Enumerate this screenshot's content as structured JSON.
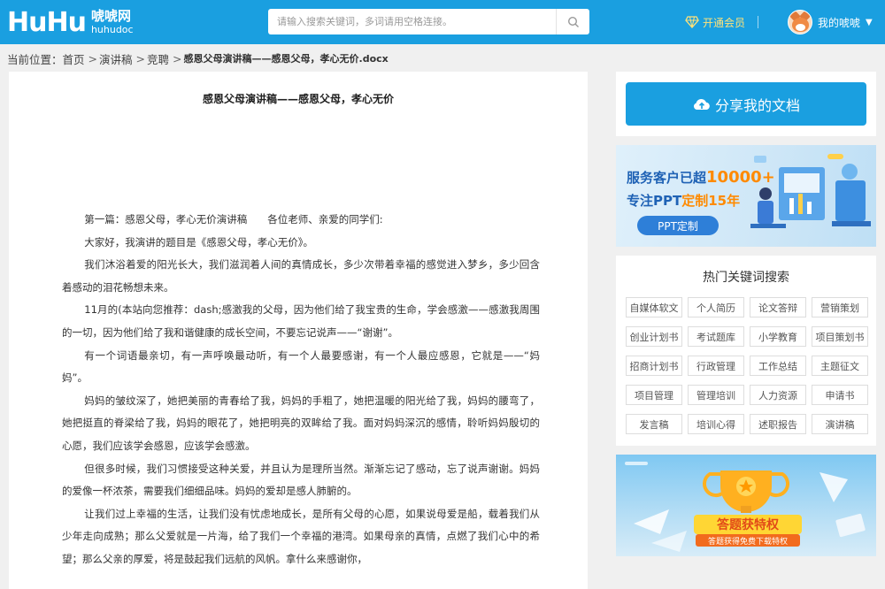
{
  "header": {
    "logo_mark": "HuHu",
    "logo_cn": "唬唬网",
    "logo_en": "huhudoc",
    "search_placeholder": "请输入搜索关键词，多词请用空格连接。",
    "vip_label": "开通会员",
    "user_label": "我的唬唬"
  },
  "breadcrumb": {
    "prefix": "当前位置：",
    "items": [
      "首页",
      "演讲稿",
      "竞聘"
    ],
    "current": "感恩父母演讲稿——感恩父母，孝心无价.docx"
  },
  "document": {
    "title": "感恩父母演讲稿——感恩父母，孝心无价",
    "paragraphs": [
      "第一篇：感恩父母，孝心无价演讲稿　　各位老师、亲爱的同学们:",
      "大家好，我演讲的题目是《感恩父母，孝心无价》。",
      "我们沐浴着爱的阳光长大，我们滋润着人间的真情成长，多少次带着幸福的感觉进入梦乡，多少回含着感动的泪花畅想未来。",
      "11月的(本站向您推荐：dash;感激我的父母，因为他们给了我宝贵的生命，学会感激——感激我周围的一切，因为他们给了我和谐健康的成长空间，不要忘记说声——“谢谢”。",
      "有一个词语最亲切，有一声呼唤最动听，有一个人最要感谢，有一个人最应感恩，它就是——“妈妈”。",
      "妈妈的皱纹深了，她把美丽的青春给了我，妈妈的手粗了，她把温暖的阳光给了我，妈妈的腰弯了，她把挺直的脊梁给了我，妈妈的眼花了，她把明亮的双眸给了我。面对妈妈深沉的感情，聆听妈妈殷切的心愿，我们应该学会感恩，应该学会感激。",
      "但很多时候，我们习惯接受这种关爱，并且认为是理所当然。渐渐忘记了感动，忘了说声谢谢。妈妈的爱像一杯浓茶，需要我们细细品味。妈妈的爱却是感人肺腑的。",
      "让我们过上幸福的生活，让我们没有忧虑地成长，是所有父母的心愿，如果说母爱是船，载着我们从少年走向成熟；那么父爱就是一片海，给了我们一个幸福的港湾。如果母亲的真情，点燃了我们心中的希望；那么父亲的厚爱，将是鼓起我们远航的风帆。拿什么来感谢你，"
    ]
  },
  "sidebar": {
    "share_label": "分享我的文档",
    "banner1": {
      "line1_prefix": "服务客户已超",
      "line1_number": "10000+",
      "line2_prefix": "专注PPT",
      "line2_highlight": "定制15年",
      "button": "PPT定制"
    },
    "keywords_title": "热门关键词搜索",
    "keywords": [
      "自媒体软文",
      "个人简历",
      "论文答辩",
      "营销策划",
      "创业计划书",
      "考试题库",
      "小学教育",
      "项目策划书",
      "招商计划书",
      "行政管理",
      "工作总结",
      "主题征文",
      "项目管理",
      "管理培训",
      "人力资源",
      "申请书",
      "发言稿",
      "培训心得",
      "述职报告",
      "演讲稿"
    ],
    "banner2": {
      "headline": "答题获特权",
      "sub": "答题获得免费下载特权"
    }
  },
  "colors": {
    "brand_blue": "#1a9fe0",
    "vip_gold": "#ffe27a",
    "page_bg": "#f0f0f0"
  }
}
